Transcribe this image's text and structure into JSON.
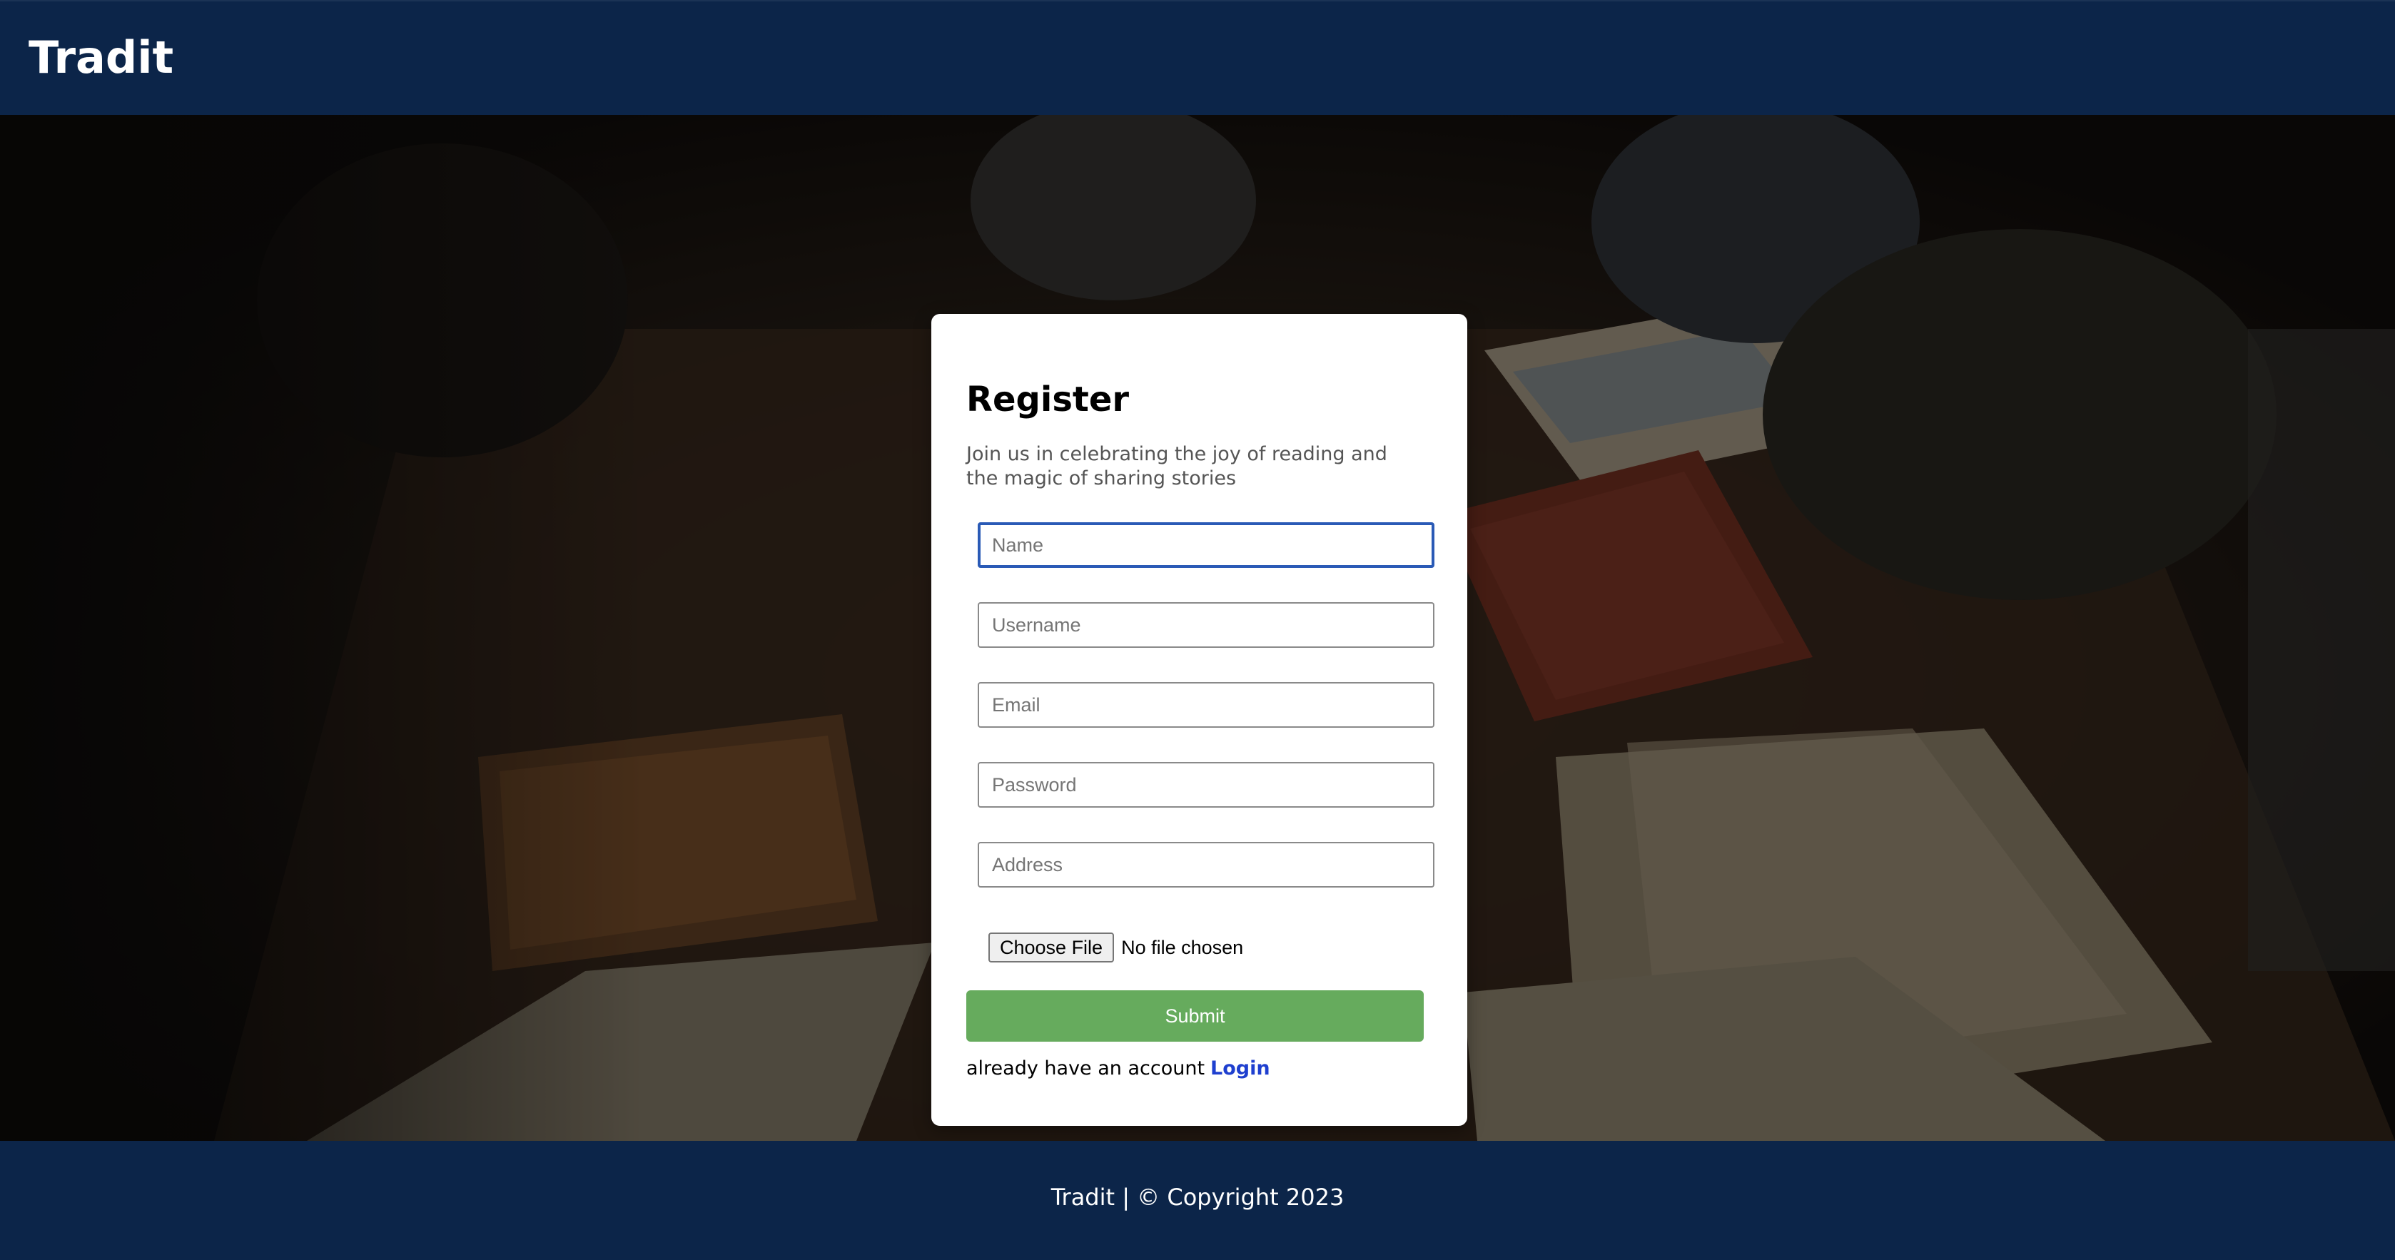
{
  "navbar": {
    "brand": "Tradit"
  },
  "register": {
    "title": "Register",
    "subtitle": "Join us in celebrating the joy of reading and the magic of sharing stories",
    "fields": {
      "name": {
        "placeholder": "Name",
        "value": ""
      },
      "username": {
        "placeholder": "Username",
        "value": ""
      },
      "email": {
        "placeholder": "Email",
        "value": ""
      },
      "password": {
        "placeholder": "Password",
        "value": ""
      },
      "address": {
        "placeholder": "Address",
        "value": ""
      }
    },
    "file": {
      "button_label": "Choose File",
      "status": "No file chosen"
    },
    "submit_label": "Submit",
    "login_prompt": "already have an account",
    "login_link": "Login"
  },
  "footer": {
    "text": "Tradit | © Copyright 2023"
  },
  "colors": {
    "navbar": "#0c2549",
    "submit": "#66ab5d",
    "link": "#1e3fcf",
    "focus_border": "#2a5ab6"
  }
}
